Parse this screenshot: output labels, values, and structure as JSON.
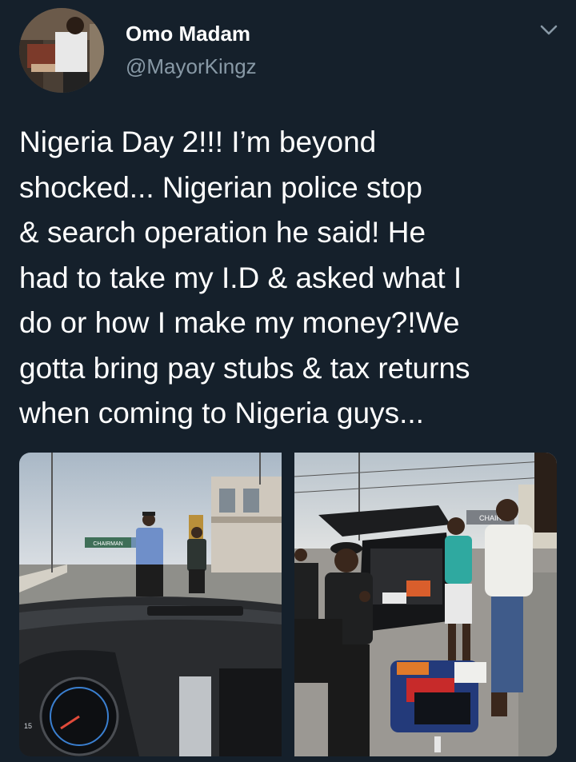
{
  "tweet": {
    "author": {
      "display_name": "Omo Madam",
      "handle": "@MayorKingz",
      "avatar_icon": "profile-photo"
    },
    "text": "Nigeria Day 2!!! I’m beyond\nshocked... Nigerian police stop\n& search operation he said! He\nhad to take my I.D & asked what I\ndo or how I make my money?!We\ngotta bring pay stubs & tax returns\nwhen coming to Nigeria guys...",
    "menu_icon": "chevron-down-icon",
    "media": [
      {
        "name": "photo-dashboard-police",
        "signs": [
          "CHAIRMAN"
        ],
        "dashboard_reading": "15"
      },
      {
        "name": "photo-car-search",
        "signs": [
          "CHAIR"
        ]
      }
    ]
  },
  "colors": {
    "background": "#15202b",
    "text_primary": "#ffffff",
    "text_secondary": "#8899a6"
  }
}
